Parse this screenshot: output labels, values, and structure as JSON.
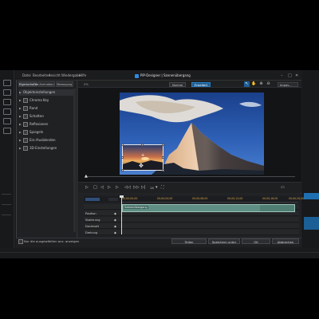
{
  "app": {
    "title": "PiP-Designer | Szenenübergang",
    "accent": "#1f5f95"
  },
  "menu": {
    "items": [
      "Datei",
      "Bearbeiten",
      "Ansicht",
      "Wiedergabe",
      "Hilfe"
    ]
  },
  "window_controls": [
    "–",
    "□",
    "✕"
  ],
  "left_panel": {
    "tabs": [
      "Eigenschaften",
      "Animation",
      "Bewegung"
    ],
    "properties": [
      {
        "label": "Objekteinstellungen",
        "checkbox": false,
        "selected": true
      },
      {
        "label": "Chroma Key",
        "checkbox": true
      },
      {
        "label": "Rand",
        "checkbox": true
      },
      {
        "label": "Schatten",
        "checkbox": true
      },
      {
        "label": "Reflexionen",
        "checkbox": true
      },
      {
        "label": "Spiegeln",
        "checkbox": true
      },
      {
        "label": "Ein-/Ausblenden",
        "checkbox": true
      },
      {
        "label": "3D-Einstellungen",
        "checkbox": true
      }
    ]
  },
  "preview_toolbar": {
    "zoom_percent": "0%",
    "btn_normal": "Normal",
    "btn_advanced": "Erweitert",
    "zoom_select": "Anpas...",
    "icons": [
      "pointer-icon",
      "hand-icon",
      "zoom-in-icon",
      "zoom-out-icon",
      "fit-icon"
    ]
  },
  "playback": {
    "speed": "1X",
    "icons": [
      "play-icon",
      "stop-icon",
      "prev-frame-icon",
      "next-frame-icon",
      "fast-forward-icon",
      "rewind-icon"
    ]
  },
  "timeline": {
    "timecodes": [
      "00;00;00;00",
      "00;00;04;00",
      "00;00;08;00",
      "00;00;12;00",
      "00;00;16;00",
      "00;00;20;00"
    ],
    "rows": [
      "Position",
      "Skalierung",
      "Deckkraft",
      "Drehung"
    ],
    "clip_label": "Szenenübergang"
  },
  "bottom": {
    "checkbox_label": "Nur die ausgewählten anz. anzeigen",
    "btn_save": "Teilen",
    "btn_save_as": "Speichern unter",
    "btn_ok": "OK",
    "btn_cancel": "Abbrechen"
  }
}
